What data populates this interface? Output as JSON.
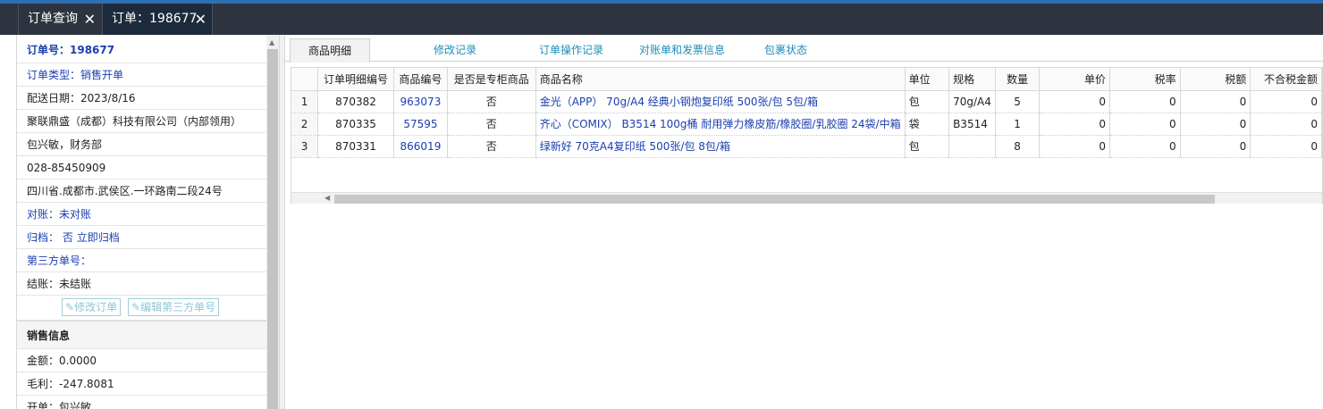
{
  "window_tabs": [
    {
      "label": "订单查询",
      "close": "✕"
    },
    {
      "label": "订单：198677",
      "close": "✕"
    }
  ],
  "sidebar": {
    "order_no": "订单号：198677",
    "order_type": "订单类型：销售开单",
    "delivery_date": "配送日期：2023/8/16",
    "company": "聚联鼎盛（成都）科技有限公司（内部领用）",
    "contact": "包兴敏，财务部",
    "phone": "028-85450909",
    "address": "四川省.成都市.武侯区.一环路南二段24号",
    "reconcile": "对账：未对账",
    "archive_label": "归档：",
    "archive_value": "否",
    "archive_link": "立即归档",
    "third_party": "第三方单号：",
    "settle": "结账：未结账",
    "edit_order_btn": "修改订单",
    "edit_third_btn": "编辑第三方单号",
    "sales_section": "销售信息",
    "amount": "金额：0.0000",
    "profit": "毛利：-247.8081",
    "biller": "开单：包兴敏"
  },
  "main_tabs": [
    {
      "label": "商品明细",
      "active": true
    },
    {
      "label": "修改记录",
      "active": false
    },
    {
      "label": "订单操作记录",
      "active": false
    },
    {
      "label": "对账单和发票信息",
      "active": false
    },
    {
      "label": "包裹状态",
      "active": false
    }
  ],
  "table": {
    "headers": [
      "",
      "订单明细编号",
      "商品编号",
      "是否是专柜商品",
      "商品名称",
      "单位",
      "规格",
      "数量",
      "单价",
      "税率",
      "税额",
      "不合税金额"
    ],
    "rows": [
      [
        "1",
        "870382",
        "963073",
        "否",
        "金光（APP） 70g/A4 经典小钢炮复印纸 500张/包 5包/箱",
        "包",
        "70g/A4",
        "5",
        "0",
        "0",
        "0",
        "0"
      ],
      [
        "2",
        "870335",
        "57595",
        "否",
        "齐心（COMIX） B3514 100g桶 耐用弹力橡皮筋/橡胶圈/乳胶圈 24袋/中箱",
        "袋",
        "B3514",
        "1",
        "0",
        "0",
        "0",
        "0"
      ],
      [
        "3",
        "870331",
        "866019",
        "否",
        "绿新好 70克A4复印纸 500张/包 8包/箱",
        "包",
        "",
        "8",
        "0",
        "0",
        "0",
        "0"
      ]
    ]
  },
  "colors": {
    "link": "#1a3fb0",
    "tab_link": "#1f8db8",
    "topbar": "#2d3440",
    "accent": "#2e6fb3"
  }
}
